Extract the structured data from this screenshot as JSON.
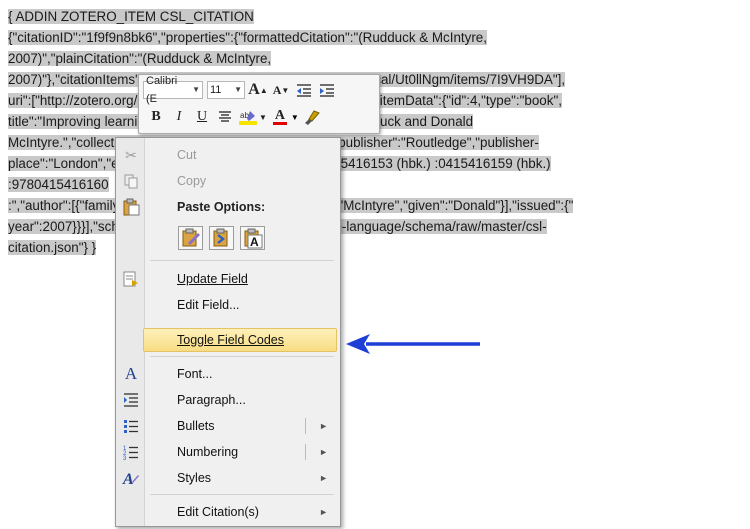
{
  "document": {
    "lines": [
      {
        "text": "{ ADDIN ZOTERO_ITEM CSL_CITATION"
      },
      {
        "text": "{\"citationID\":\"1f9f9n8bk6\",\"properties\":{\"formattedCitation\":\"(Rudduck & McIntyre,"
      },
      {
        "text": "2007)\",\"plainCitation\":\"(Rudduck & McIntyre,"
      },
      {
        "text": "2007)\"},\"citationItems\":[{\"id\":4,\"uris\":[\"http://zotero.org/users/local/Ut0llNgm/items/7I9VH9DA\"],"
      },
      {
        "text": "uri\":[\"http://zotero.org/users/local/Ut0llNgm/items/7I9VH9DA\"],\"itemData\":{\"id\":4,\"type\":\"book\","
      },
      {
        "text": "title\":\"Improving learning through consulting pupils / Jean Rudduck and Donald"
      },
      {
        "text": "McIntyre.\",\"collection-title\":\"Improving Learning TLRP.\",\"publisher\":\"Routledge\",\"publisher-"
      },
      {
        "text": "place\":\"London\",\"event-place\":\"London\",\"ISBN\":\"9780415416153 (hbk.) :0415416159 (hbk.)"
      },
      {
        "text": ":9780415416160"
      },
      {
        "text": ":\",\"author\":[{\"family\":\"Rudduck\",\"given\":\"Jean\"},{\"family\":\"McIntyre\",\"given\":\"Donald\"}],\"issued\":{\""
      },
      {
        "text": "year\":2007}}}],\"schema\":\"https://github.com/citation-style-language/schema/raw/master/csl-"
      },
      {
        "text": "citation.json\"} }"
      }
    ]
  },
  "mini_toolbar": {
    "font": "Calibri (E",
    "size": "11",
    "grow": "A",
    "shrink": "A",
    "bold": "B",
    "italic": "I",
    "underline": "U",
    "font_color": "A"
  },
  "context_menu": {
    "items": {
      "cut": "Cut",
      "copy": "Copy",
      "paste_options": "Paste Options:",
      "update_field": "Update Field",
      "edit_field": "Edit Field...",
      "toggle_field_codes": "Toggle Field Codes",
      "font": "Font...",
      "paragraph": "Paragraph...",
      "bullets": "Bullets",
      "numbering": "Numbering",
      "styles": "Styles",
      "edit_citation": "Edit Citation(s)"
    }
  },
  "colors": {
    "highlight_selection": "#c9c9c9",
    "menu_hover": "#f9dd84",
    "arrow": "#1d3fd6"
  }
}
